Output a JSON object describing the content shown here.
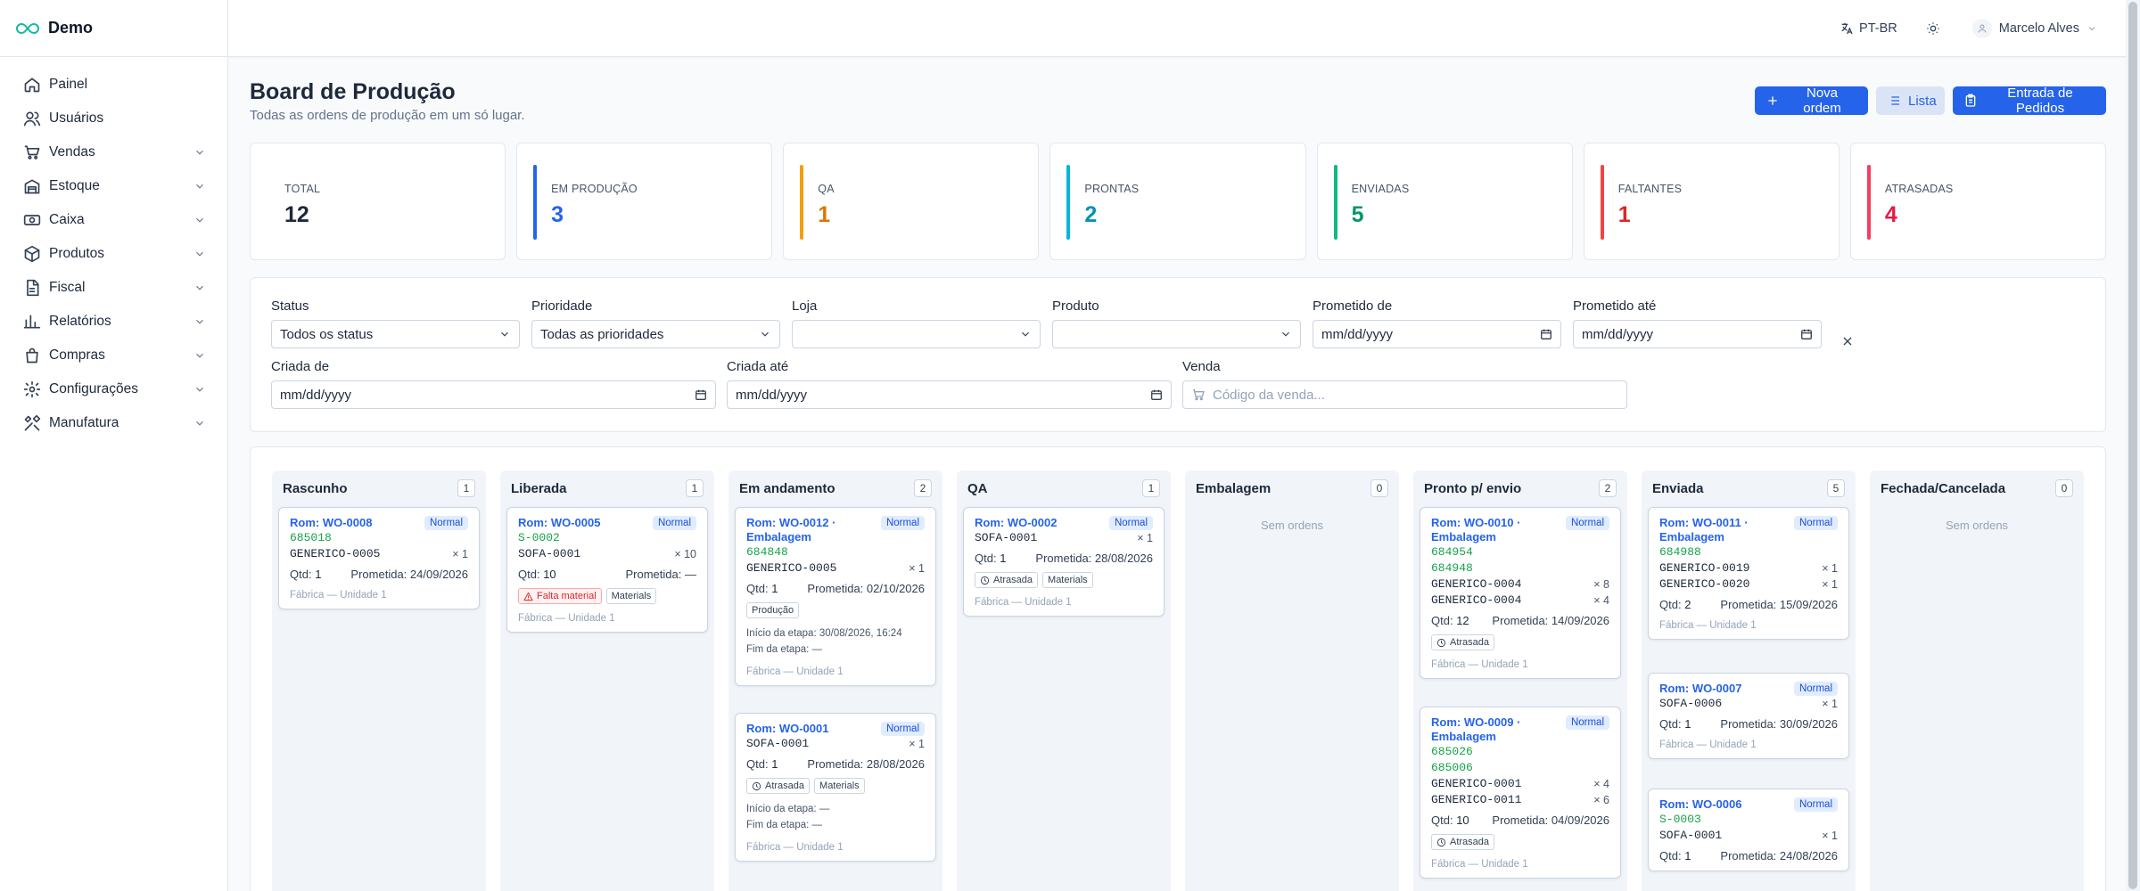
{
  "app": {
    "name": "Demo"
  },
  "sidebar": {
    "items": [
      {
        "label": "Painel",
        "icon": "home-icon",
        "expandable": false
      },
      {
        "label": "Usuários",
        "icon": "users-icon",
        "expandable": false
      },
      {
        "label": "Vendas",
        "icon": "cart-icon",
        "expandable": true
      },
      {
        "label": "Estoque",
        "icon": "warehouse-icon",
        "expandable": true
      },
      {
        "label": "Caixa",
        "icon": "cash-icon",
        "expandable": true
      },
      {
        "label": "Produtos",
        "icon": "box-icon",
        "expandable": true
      },
      {
        "label": "Fiscal",
        "icon": "document-icon",
        "expandable": true
      },
      {
        "label": "Relatórios",
        "icon": "chart-icon",
        "expandable": true
      },
      {
        "label": "Compras",
        "icon": "bag-icon",
        "expandable": true
      },
      {
        "label": "Configurações",
        "icon": "gear-icon",
        "expandable": true
      },
      {
        "label": "Manufatura",
        "icon": "tools-icon",
        "expandable": true
      }
    ]
  },
  "header": {
    "language": "PT-BR",
    "user_name": "Marcelo Alves"
  },
  "page": {
    "title": "Board de Produção",
    "subtitle": "Todas as ordens de produção em um só lugar.",
    "actions": {
      "new_order": "Nova ordem",
      "list": "Lista",
      "orders_entry": "Entrada de Pedidos"
    }
  },
  "stats": [
    {
      "label": "TOTAL",
      "value": "12",
      "color": "#1e293b",
      "bar": ""
    },
    {
      "label": "EM PRODUÇÃO",
      "value": "3",
      "color": "#2563eb",
      "bar": "#2563eb"
    },
    {
      "label": "QA",
      "value": "1",
      "color": "#d97706",
      "bar": "#f59e0b"
    },
    {
      "label": "PRONTAS",
      "value": "2",
      "color": "#0891b2",
      "bar": "#06b6d4"
    },
    {
      "label": "ENVIADAS",
      "value": "5",
      "color": "#059669",
      "bar": "#10b981"
    },
    {
      "label": "FALTANTES",
      "value": "1",
      "color": "#dc2626",
      "bar": "#ef4444"
    },
    {
      "label": "ATRASADAS",
      "value": "4",
      "color": "#e11d48",
      "bar": "#f43f5e"
    }
  ],
  "filters": {
    "status": {
      "label": "Status",
      "value": "Todos os status"
    },
    "priority": {
      "label": "Prioridade",
      "value": "Todas as prioridades"
    },
    "store": {
      "label": "Loja",
      "value": ""
    },
    "product": {
      "label": "Produto",
      "value": ""
    },
    "promised_from": {
      "label": "Prometido de",
      "value": "mm/dd/yyyy"
    },
    "promised_to": {
      "label": "Prometido até",
      "value": "mm/dd/yyyy"
    },
    "created_from": {
      "label": "Criada de",
      "value": "mm/dd/yyyy"
    },
    "created_to": {
      "label": "Criada até",
      "value": "mm/dd/yyyy"
    },
    "sale": {
      "label": "Venda",
      "placeholder": "Código da venda..."
    }
  },
  "board": {
    "qty_label": "Qtd:",
    "promised_label": "Prometida:",
    "stage_start_label": "Início da etapa:",
    "stage_end_label": "Fim da etapa:",
    "columns": [
      {
        "title": "Rascunho",
        "count": "1",
        "empty_text": "",
        "cards": [
          {
            "title": "Rom: WO-0008",
            "priority": "Normal",
            "sales": [
              "685018"
            ],
            "lines": [
              {
                "sku": "GENERICO-0005",
                "qty": "× 1"
              }
            ],
            "qty": "1",
            "promised": "24/09/2026",
            "tags": [],
            "stage": null,
            "location": "Fábrica — Unidade 1"
          }
        ]
      },
      {
        "title": "Liberada",
        "count": "1",
        "empty_text": "",
        "cards": [
          {
            "title": "Rom: WO-0005",
            "priority": "Normal",
            "sales": [
              "S-0002"
            ],
            "lines": [
              {
                "sku": "SOFA-0001",
                "qty": "× 10"
              }
            ],
            "qty": "10",
            "promised": "—",
            "tags": [
              {
                "text": "Falta material",
                "style": "red",
                "icon": "warning-icon"
              },
              {
                "text": "Materials",
                "style": "",
                "icon": ""
              }
            ],
            "stage": null,
            "location": "Fábrica — Unidade 1"
          }
        ]
      },
      {
        "title": "Em andamento",
        "count": "2",
        "empty_text": "",
        "cards": [
          {
            "title": "Rom: WO-0012 · Embalagem",
            "priority": "Normal",
            "sales": [
              "684848"
            ],
            "lines": [
              {
                "sku": "GENERICO-0005",
                "qty": "× 1"
              }
            ],
            "qty": "1",
            "promised": "02/10/2026",
            "tags": [
              {
                "text": "Produção",
                "style": "",
                "icon": ""
              }
            ],
            "stage": {
              "start": "30/08/2026, 16:24",
              "end": "—"
            },
            "location": "Fábrica — Unidade 1"
          },
          {
            "title": "Rom: WO-0001",
            "priority": "Normal",
            "sales": [],
            "lines": [
              {
                "sku": "SOFA-0001",
                "qty": "× 1"
              }
            ],
            "qty": "1",
            "promised": "28/08/2026",
            "tags": [
              {
                "text": "Atrasada",
                "style": "",
                "icon": "clock-icon"
              },
              {
                "text": "Materials",
                "style": "",
                "icon": ""
              }
            ],
            "stage": {
              "start": "—",
              "end": "—"
            },
            "location": "Fábrica — Unidade 1"
          }
        ]
      },
      {
        "title": "QA",
        "count": "1",
        "empty_text": "",
        "cards": [
          {
            "title": "Rom: WO-0002",
            "priority": "Normal",
            "sales": [],
            "lines": [
              {
                "sku": "SOFA-0001",
                "qty": "× 1"
              }
            ],
            "qty": "1",
            "promised": "28/08/2026",
            "tags": [
              {
                "text": "Atrasada",
                "style": "",
                "icon": "clock-icon"
              },
              {
                "text": "Materials",
                "style": "",
                "icon": ""
              }
            ],
            "stage": null,
            "location": "Fábrica — Unidade 1"
          }
        ]
      },
      {
        "title": "Embalagem",
        "count": "0",
        "empty_text": "Sem ordens",
        "cards": []
      },
      {
        "title": "Pronto p/ envio",
        "count": "2",
        "empty_text": "",
        "cards": [
          {
            "title": "Rom: WO-0010 · Embalagem",
            "priority": "Normal",
            "sales": [
              "684954",
              "684948"
            ],
            "lines": [
              {
                "sku": "GENERICO-0004",
                "qty": "× 8"
              },
              {
                "sku": "GENERICO-0004",
                "qty": "× 4"
              }
            ],
            "qty": "12",
            "promised": "14/09/2026",
            "tags": [
              {
                "text": "Atrasada",
                "style": "",
                "icon": "clock-icon"
              }
            ],
            "stage": null,
            "location": "Fábrica — Unidade 1"
          },
          {
            "title": "Rom: WO-0009 · Embalagem",
            "priority": "Normal",
            "sales": [
              "685026",
              "685006"
            ],
            "lines": [
              {
                "sku": "GENERICO-0001",
                "qty": "× 4"
              },
              {
                "sku": "GENERICO-0011",
                "qty": "× 6"
              }
            ],
            "qty": "10",
            "promised": "04/09/2026",
            "tags": [
              {
                "text": "Atrasada",
                "style": "",
                "icon": "clock-icon"
              }
            ],
            "stage": null,
            "location": "Fábrica — Unidade 1"
          }
        ]
      },
      {
        "title": "Enviada",
        "count": "5",
        "empty_text": "",
        "cards": [
          {
            "title": "Rom: WO-0011 · Embalagem",
            "priority": "Normal",
            "sales": [
              "684988"
            ],
            "lines": [
              {
                "sku": "GENERICO-0019",
                "qty": "× 1"
              },
              {
                "sku": "GENERICO-0020",
                "qty": "× 1"
              }
            ],
            "qty": "2",
            "promised": "15/09/2026",
            "tags": [],
            "stage": null,
            "location": "Fábrica — Unidade 1"
          },
          {
            "title": "Rom: WO-0007",
            "priority": "Normal",
            "sales": [],
            "lines": [
              {
                "sku": "SOFA-0006",
                "qty": "× 1"
              }
            ],
            "qty": "1",
            "promised": "30/09/2026",
            "tags": [],
            "stage": null,
            "location": "Fábrica — Unidade 1"
          },
          {
            "title": "Rom: WO-0006",
            "priority": "Normal",
            "sales": [
              "S-0003"
            ],
            "lines": [
              {
                "sku": "SOFA-0001",
                "qty": "× 1"
              }
            ],
            "qty": "1",
            "promised": "24/08/2026",
            "tags": [],
            "stage": null,
            "location": ""
          }
        ]
      },
      {
        "title": "Fechada/Cancelada",
        "count": "0",
        "empty_text": "Sem ordens",
        "cards": []
      }
    ]
  },
  "colors": {
    "accent": "#2563eb",
    "sale_green": "#16a34a",
    "danger": "#dc2626"
  }
}
